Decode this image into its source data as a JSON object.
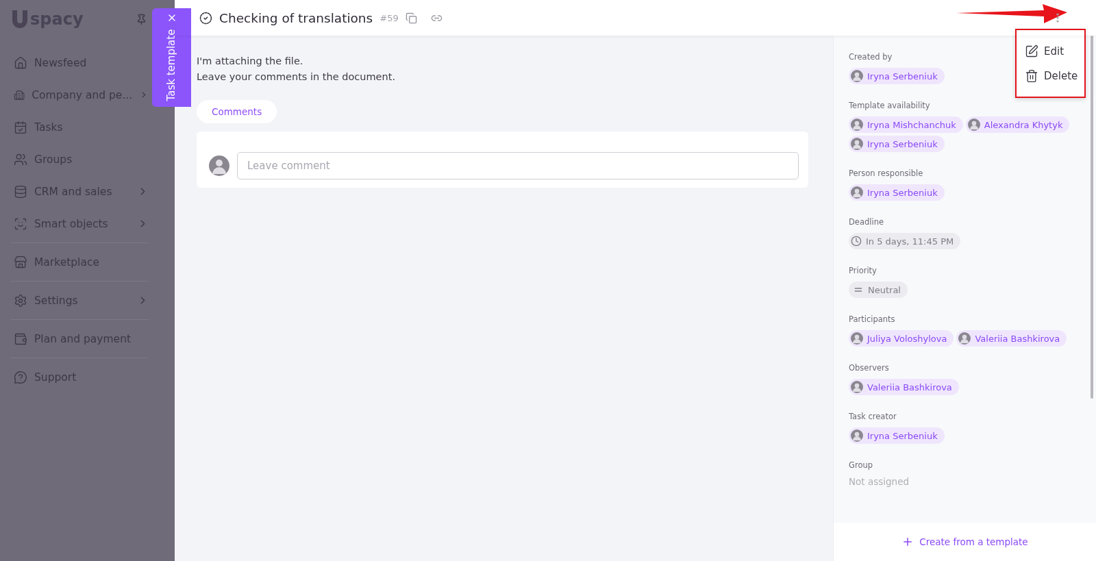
{
  "sidebar": {
    "logo": "spacy",
    "groups": [
      [
        {
          "label": "Newsfeed",
          "submenu": false
        },
        {
          "label": "Company and pe...",
          "submenu": true
        },
        {
          "label": "Tasks",
          "submenu": false
        },
        {
          "label": "Groups",
          "submenu": false
        },
        {
          "label": "CRM and sales",
          "submenu": true
        },
        {
          "label": "Smart objects",
          "submenu": true
        }
      ],
      [
        {
          "label": "Marketplace",
          "submenu": false
        }
      ],
      [
        {
          "label": "Settings",
          "submenu": true
        }
      ],
      [
        {
          "label": "Plan and payment",
          "submenu": false
        }
      ],
      [
        {
          "label": "Support",
          "submenu": false
        }
      ]
    ]
  },
  "side_tab": {
    "label": "Task template"
  },
  "header": {
    "title": "Checking of translations",
    "number": "#59"
  },
  "description": [
    "I'm attaching the file.",
    "Leave your comments in the document."
  ],
  "comments": {
    "tab": "Comments",
    "placeholder": "Leave comment"
  },
  "details": [
    {
      "kind": "people",
      "label": "Created by",
      "people": [
        "Iryna Serbeniuk"
      ]
    },
    {
      "kind": "people",
      "label": "Template availability",
      "people": [
        "Iryna Mishchanchuk",
        "Alexandra Khytyk",
        "Iryna Serbeniuk"
      ]
    },
    {
      "kind": "people",
      "label": "Person responsible",
      "people": [
        "Iryna Serbeniuk"
      ]
    },
    {
      "kind": "deadline",
      "label": "Deadline",
      "value": "In 5 days, 11:45 PM"
    },
    {
      "kind": "priority",
      "label": "Priority",
      "value": "Neutral"
    },
    {
      "kind": "people",
      "label": "Participants",
      "people": [
        "Juliya Voloshylova",
        "Valeriia Bashkirova"
      ]
    },
    {
      "kind": "people",
      "label": "Observers",
      "people": [
        "Valeriia Bashkirova"
      ]
    },
    {
      "kind": "people",
      "label": "Task creator",
      "people": [
        "Iryna Serbeniuk"
      ]
    },
    {
      "kind": "text",
      "label": "Group",
      "value": "Not assigned"
    }
  ],
  "footer": {
    "action": "Create from a template"
  },
  "menu": {
    "items": [
      "Edit",
      "Delete"
    ]
  }
}
